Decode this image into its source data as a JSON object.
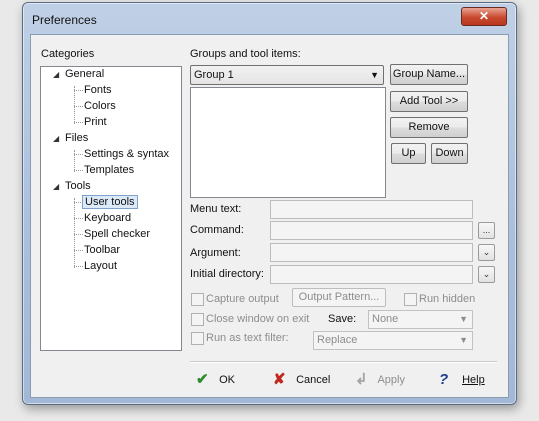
{
  "window": {
    "title": "Preferences",
    "close_glyph": "✕"
  },
  "categories": {
    "heading": "Categories",
    "items": [
      {
        "label": "General",
        "level": 0
      },
      {
        "label": "Fonts",
        "level": 1
      },
      {
        "label": "Colors",
        "level": 1
      },
      {
        "label": "Print",
        "level": 1
      },
      {
        "label": "Files",
        "level": 0
      },
      {
        "label": "Settings & syntax",
        "level": 1
      },
      {
        "label": "Templates",
        "level": 1
      },
      {
        "label": "Tools",
        "level": 0
      },
      {
        "label": "User tools",
        "level": 1,
        "selected": true
      },
      {
        "label": "Keyboard",
        "level": 1
      },
      {
        "label": "Spell checker",
        "level": 1
      },
      {
        "label": "Toolbar",
        "level": 1
      },
      {
        "label": "Layout",
        "level": 1
      }
    ]
  },
  "groups": {
    "heading": "Groups and tool items:",
    "selected_group": "Group 1",
    "group_name_button": "Group Name...",
    "add_tool_button": "Add Tool >>",
    "remove_button": "Remove",
    "up_button": "Up",
    "down_button": "Down"
  },
  "fields": {
    "menu_text": "Menu text:",
    "command": "Command:",
    "command_browse": "...",
    "argument": "Argument:",
    "initial_directory": "Initial directory:"
  },
  "options": {
    "capture_output": "Capture output",
    "output_pattern_button": "Output Pattern...",
    "run_hidden": "Run hidden",
    "close_window_on_exit": "Close window on exit",
    "save_label": "Save:",
    "save_value": "None",
    "run_as_text_filter": "Run as text filter:",
    "filter_value": "Replace"
  },
  "footer": {
    "ok": "OK",
    "cancel": "Cancel",
    "apply": "Apply",
    "help": "Help"
  },
  "colors": {
    "ok_icon": "#2e8b2e",
    "cancel_icon": "#c0281e",
    "help_icon": "#1d3f8a",
    "close_button": "#c9492f"
  }
}
